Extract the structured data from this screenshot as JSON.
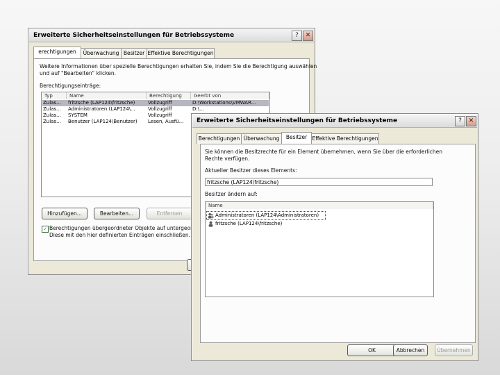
{
  "back_dialog": {
    "title": "Erweiterte Sicherheitseinstellungen für Betriebssysteme",
    "tabs": [
      "erechtigungen",
      "Überwachung",
      "Besitzer",
      "Effektive Berechtigungen"
    ],
    "info_line1": "Weitere Informationen über spezielle Berechtigungen erhalten Sie, indem Sie die Berechtigung auswählen",
    "info_line2": "und auf \"Bearbeiten\" klicken.",
    "entries_label": "Berechtigungseinträge:",
    "columns": [
      "Typ",
      "Name",
      "Berechtigung",
      "Geerbt von"
    ],
    "rows": [
      [
        "Zulas...",
        "fritzsche (LAP124\\fritzsche)",
        "Vollzugriff",
        "D:\\Workstations\\VMWAR..."
      ],
      [
        "Zulas...",
        "Administratoren (LAP124\\...",
        "Vollzugriff",
        "D:\\..."
      ],
      [
        "Zulas...",
        "SYSTEM",
        "Vollzugriff",
        ""
      ],
      [
        "Zulas...",
        "Benutzer (LAP124\\Benutzer)",
        "Lesen, Ausfü...",
        ""
      ]
    ],
    "buttons": {
      "add": "Hinzufügen...",
      "edit": "Bearbeiten...",
      "remove": "Entfernen"
    },
    "inherit_line1": "Berechtigungen übergeordneter Objekte auf untergeordne",
    "inherit_line2": "Diese mit den hier definierten Einträgen einschließen."
  },
  "front_dialog": {
    "title": "Erweiterte Sicherheitseinstellungen für Betriebssysteme",
    "tabs": [
      "Berechtigungen",
      "Überwachung",
      "Besitzer",
      "Effektive Berechtigungen"
    ],
    "info_line1": "Sie können die Besitzrechte für ein Element übernehmen, wenn Sie über die erforderlichen",
    "info_line2": "Rechte verfügen.",
    "current_owner_label": "Aktueller Besitzer dieses Elements:",
    "current_owner_value": "fritzsche (LAP124\\fritzsche)",
    "change_owner_label": "Besitzer ändern auf:",
    "list_header": "Name",
    "owners": [
      "Administratoren (LAP124\\Administratoren)",
      "fritzsche (LAP124\\fritzsche)"
    ],
    "buttons": {
      "ok": "OK",
      "cancel": "Abbrechen",
      "apply": "Übernehmen"
    }
  },
  "help_glyph": "?",
  "close_glyph": "✕",
  "checkbox_glyph": "✓"
}
